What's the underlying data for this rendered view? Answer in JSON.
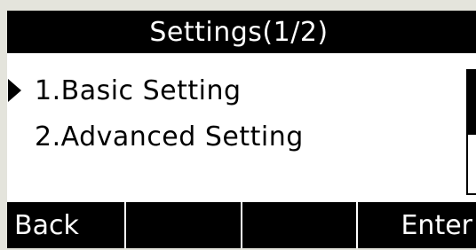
{
  "header": {
    "title": "Settings(1/2)"
  },
  "menu": {
    "items": [
      {
        "label": "1.Basic Setting",
        "selected": true
      },
      {
        "label": "2.Advanced Setting",
        "selected": false
      }
    ]
  },
  "scroll": {
    "position_fraction": 0.5
  },
  "softkeys": [
    "Back",
    "",
    "",
    "Enter"
  ],
  "colors": {
    "background": "#ffffff",
    "foreground": "#000000"
  }
}
